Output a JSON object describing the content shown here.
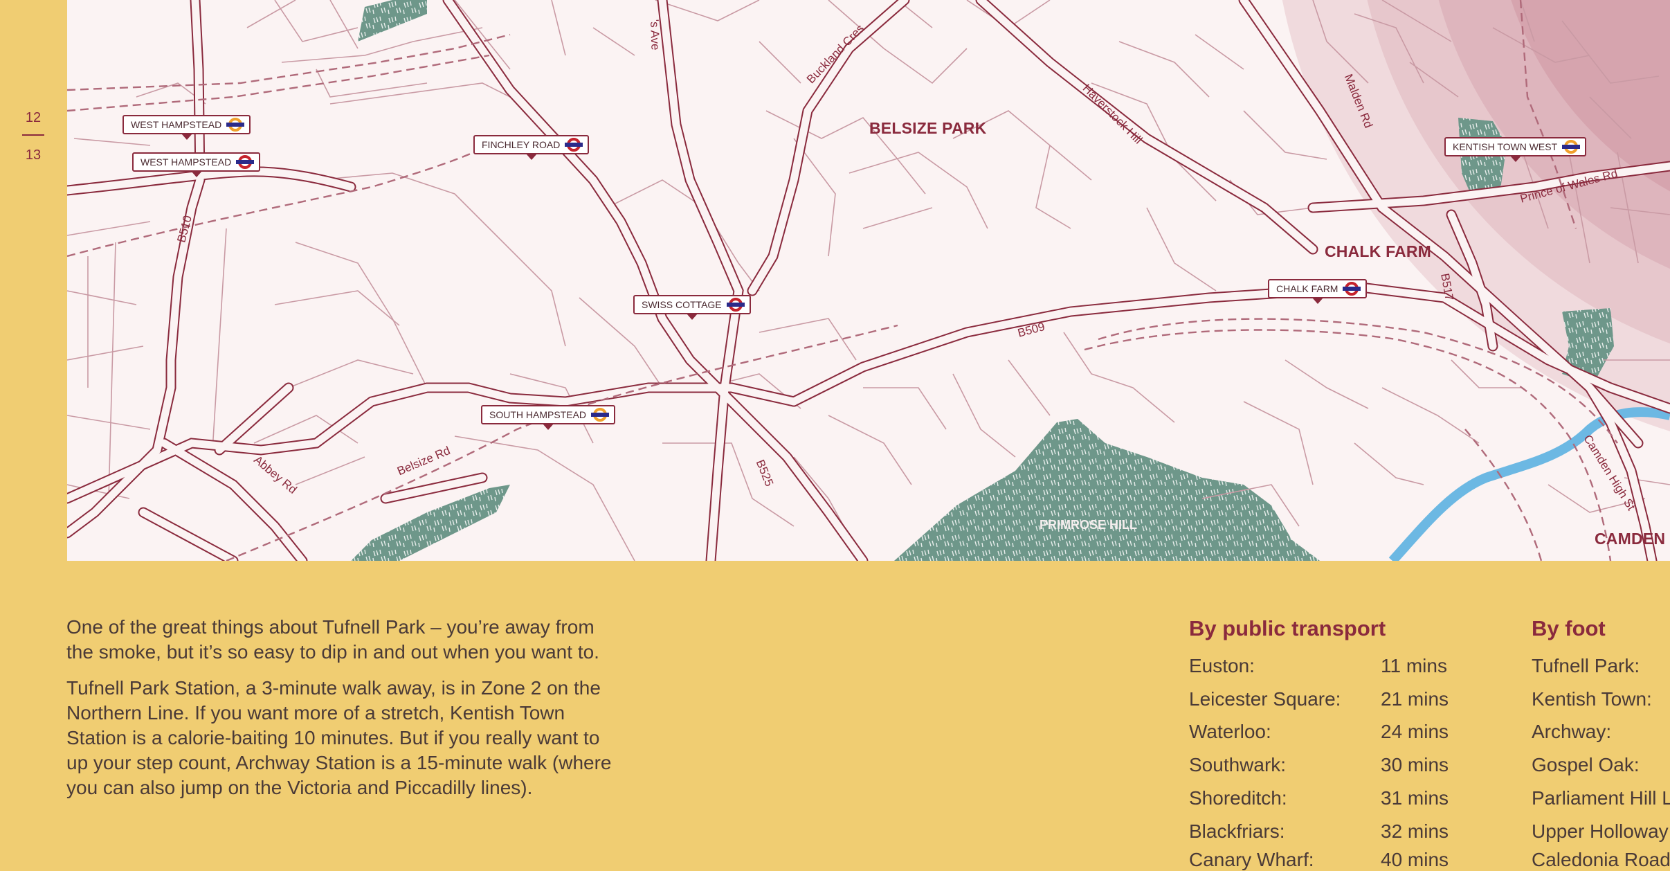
{
  "page_numbers": {
    "left": "12",
    "right": "13"
  },
  "map": {
    "areas": [
      "BELSIZE PARK",
      "CHALK FARM",
      "CAMDEN T"
    ],
    "parks": [
      "PRIMROSE HILL"
    ],
    "roads": [
      "Buckland Cres",
      "Haverstock Hill",
      "Malden Rd",
      "Prince of Wales Rd",
      "B517",
      "B509",
      "B510",
      "B525",
      "Abbey Rd",
      "Belsize Rd",
      "Camden High St",
      "'s Ave"
    ],
    "stations": [
      {
        "name": "WEST HAMPSTEAD",
        "line": "overground"
      },
      {
        "name": "WEST HAMPSTEAD",
        "line": "underground"
      },
      {
        "name": "FINCHLEY ROAD",
        "line": "underground"
      },
      {
        "name": "SWISS COTTAGE",
        "line": "underground"
      },
      {
        "name": "SOUTH HAMPSTEAD",
        "line": "overground"
      },
      {
        "name": "CHALK FARM",
        "line": "underground"
      },
      {
        "name": "KENTISH TOWN WEST",
        "line": "overground"
      }
    ],
    "colors": {
      "roads": "#8a2a3d",
      "park": "#6e978a",
      "water": "#6cb8e3",
      "background": "#fbf3f3",
      "page": "#f0cd72"
    }
  },
  "intro": {
    "p1": "One of the great things about Tufnell Park – you’re away from the smoke, but it’s so easy to dip in and out when you want to.",
    "p2": "Tufnell Park Station, a 3-minute walk away, is in Zone 2 on the Northern Line. If you want more of a stretch, Kentish Town Station is a calorie-baiting 10 minutes. But if you really want to up your step count, Archway Station is a 15-minute walk (where you can also jump on the Victoria and Piccadilly lines)."
  },
  "public_transport": {
    "heading": "By public transport",
    "rows": [
      {
        "place": "Euston:",
        "time": "11 mins"
      },
      {
        "place": "Leicester Square:",
        "time": "21 mins"
      },
      {
        "place": "Waterloo:",
        "time": "24 mins"
      },
      {
        "place": "Southwark:",
        "time": "30 mins"
      },
      {
        "place": "Shoreditch:",
        "time": "31 mins"
      },
      {
        "place": "Blackfriars:",
        "time": "32 mins"
      },
      {
        "place": "Canary Wharf:",
        "time": "40 mins"
      }
    ]
  },
  "by_foot": {
    "heading": "By foot",
    "rows": [
      {
        "place": "Tufnell Park:"
      },
      {
        "place": "Kentish Town:"
      },
      {
        "place": "Archway:"
      },
      {
        "place": "Gospel Oak:"
      },
      {
        "place": "Parliament Hill L"
      },
      {
        "place": "Upper Holloway"
      },
      {
        "place": "Caledonia Road"
      }
    ]
  }
}
